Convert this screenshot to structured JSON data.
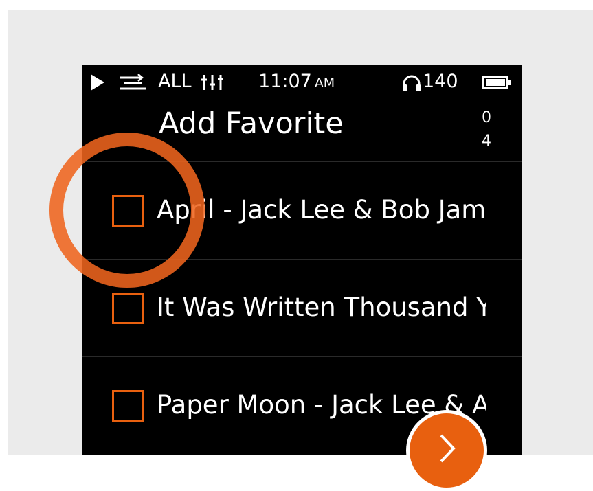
{
  "status_bar": {
    "play_icon": "play-icon",
    "repeat_icon": "repeat-icon",
    "repeat_mode": "ALL",
    "eq_icon": "equalizer-icon",
    "time": "11:07",
    "ampm": "AM",
    "headphone_icon": "headphone-icon",
    "volume": "140",
    "battery_icon": "battery-icon"
  },
  "header": {
    "title": "Add Favorite",
    "count_selected": "0",
    "count_total": "4"
  },
  "songs": [
    {
      "title": "April - Jack Lee & Bob Jam",
      "checked": false
    },
    {
      "title": "It Was Written Thousand Y",
      "checked": false
    },
    {
      "title": "Paper Moon - Jack Lee & A",
      "checked": false
    }
  ],
  "next_button": {
    "icon": "chevron-right-icon"
  },
  "colors": {
    "accent": "#e8600f",
    "highlight_ring": "#ee641e",
    "screen_background": "#000000",
    "page_background": "#ebebeb",
    "text": "#ffffff"
  }
}
